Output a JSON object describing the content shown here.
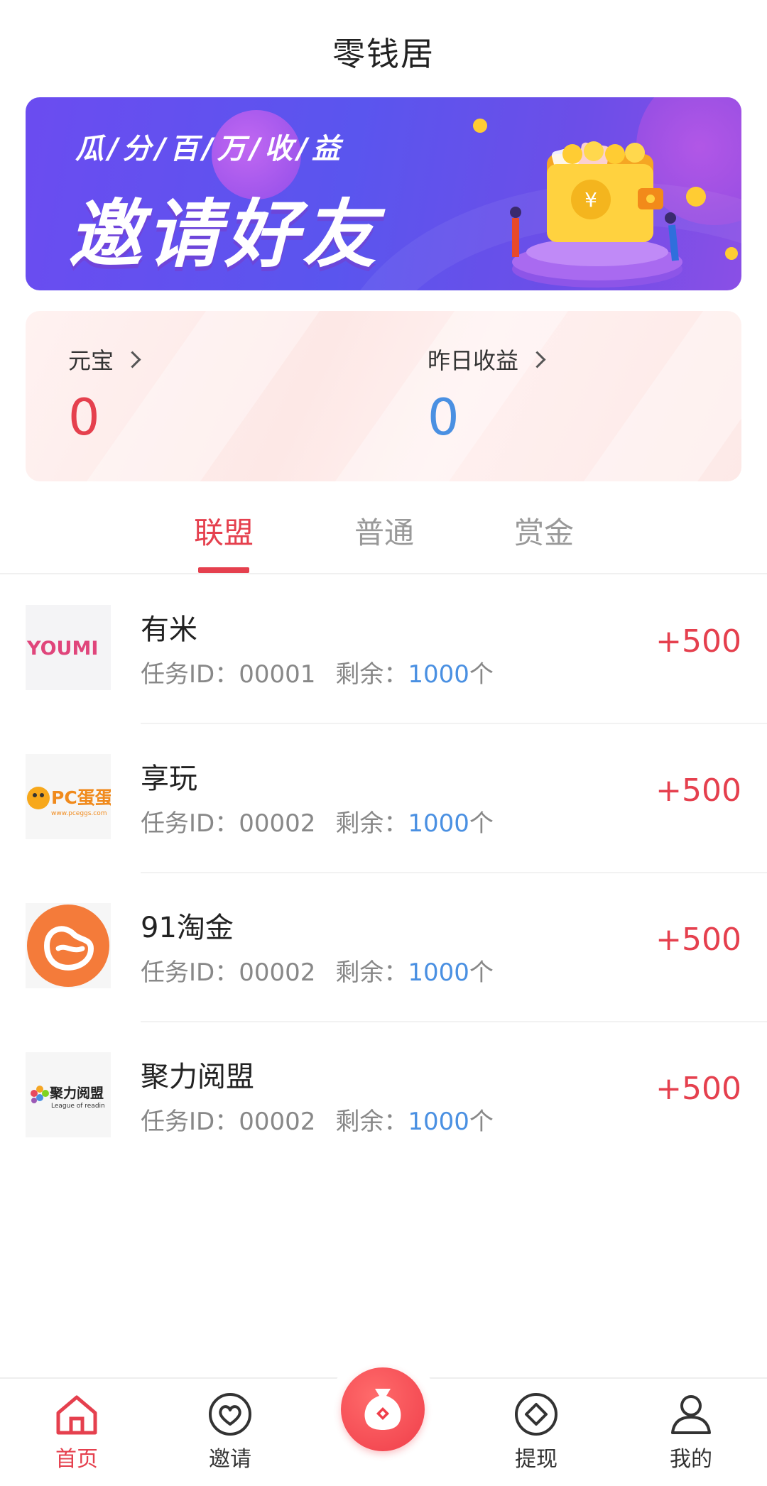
{
  "header": {
    "title": "零钱居"
  },
  "banner": {
    "subtitle": "瓜/分/百/万/收/益",
    "headline": "邀请好友"
  },
  "stats": {
    "left": {
      "label": "元宝",
      "value": "0"
    },
    "right": {
      "label": "昨日收益",
      "value": "0"
    }
  },
  "tabs": [
    {
      "label": "联盟",
      "active": true
    },
    {
      "label": "普通",
      "active": false
    },
    {
      "label": "赏金",
      "active": false
    }
  ],
  "tasks": [
    {
      "name": "有米",
      "id_label": "任务ID：",
      "id": "00001",
      "remain_label": "剩余：",
      "remain": "1000",
      "unit": "个",
      "reward": "+500",
      "logo_text": "YOUMI"
    },
    {
      "name": "享玩",
      "id_label": "任务ID：",
      "id": "00002",
      "remain_label": "剩余：",
      "remain": "1000",
      "unit": "个",
      "reward": "+500",
      "logo_text": "PC蛋蛋",
      "logo_subtext": "www.pceggs.com"
    },
    {
      "name": "91淘金",
      "id_label": "任务ID：",
      "id": "00002",
      "remain_label": "剩余：",
      "remain": "1000",
      "unit": "个",
      "reward": "+500"
    },
    {
      "name": "聚力阅盟",
      "id_label": "任务ID：",
      "id": "00002",
      "remain_label": "剩余：",
      "remain": "1000",
      "unit": "个",
      "reward": "+500",
      "logo_text": "聚力阅盟",
      "logo_subtext": "League of readin"
    }
  ],
  "nav": [
    {
      "label": "首页",
      "icon": "home-icon",
      "active": true
    },
    {
      "label": "邀请",
      "icon": "heart-icon",
      "active": false
    },
    {
      "label": "",
      "icon": "money-bag-icon",
      "active": false
    },
    {
      "label": "提现",
      "icon": "diamond-icon",
      "active": false
    },
    {
      "label": "我的",
      "icon": "user-icon",
      "active": false
    }
  ],
  "colors": {
    "accent": "#e5404e",
    "blue": "#4a90e2",
    "banner": "#6b4cf0"
  }
}
